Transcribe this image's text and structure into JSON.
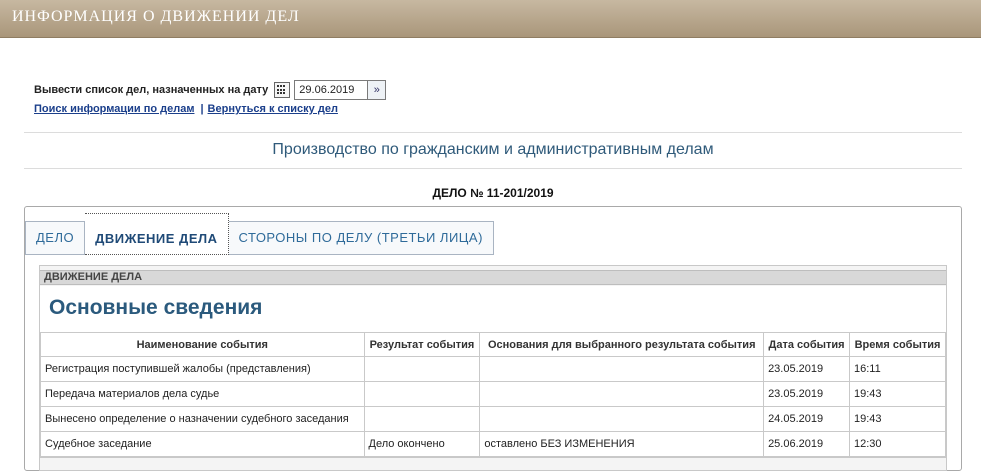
{
  "header": {
    "title": "ИНФОРМАЦИЯ О ДВИЖЕНИИ ДЕЛ"
  },
  "date_filter": {
    "label": "Вывести список дел, назначенных на дату",
    "calendar_icon": "calendar-icon",
    "date_value": "29.06.2019",
    "go_symbol": "»"
  },
  "links": {
    "search": "Поиск информации по делам",
    "separator": "|",
    "back": "Вернуться к списку дел"
  },
  "section_title": "Производство по гражданским и административным делам",
  "case_number": "ДЕЛО № 11-201/2019",
  "tabs": [
    {
      "label": "ДЕЛО"
    },
    {
      "label": "ДВИЖЕНИЕ ДЕЛА"
    },
    {
      "label": "СТОРОНЫ ПО ДЕЛУ (ТРЕТЬИ ЛИЦА)"
    }
  ],
  "active_tab": "ДВИЖЕНИЕ ДЕЛА",
  "panel": {
    "header": "ДВИЖЕНИЕ ДЕЛА",
    "heading": "Основные сведения"
  },
  "table": {
    "columns": [
      "Наименование события",
      "Результат события",
      "Основания для выбранного результата события",
      "Дата события",
      "Время события"
    ],
    "rows": [
      [
        "Регистрация поступившей жалобы (представления)",
        "",
        "",
        "23.05.2019",
        "16:11"
      ],
      [
        "Передача материалов дела судье",
        "",
        "",
        "23.05.2019",
        "19:43"
      ],
      [
        "Вынесено определение о назначении судебного заседания",
        "",
        "",
        "24.05.2019",
        "19:43"
      ],
      [
        "Судебное заседание",
        "Дело окончено",
        "оставлено БЕЗ ИЗМЕНЕНИЯ",
        "25.06.2019",
        "12:30"
      ]
    ]
  },
  "colors": {
    "header_bg": "#b5a389",
    "accent_blue": "#2f6b9a",
    "link": "#1b3f8b"
  }
}
